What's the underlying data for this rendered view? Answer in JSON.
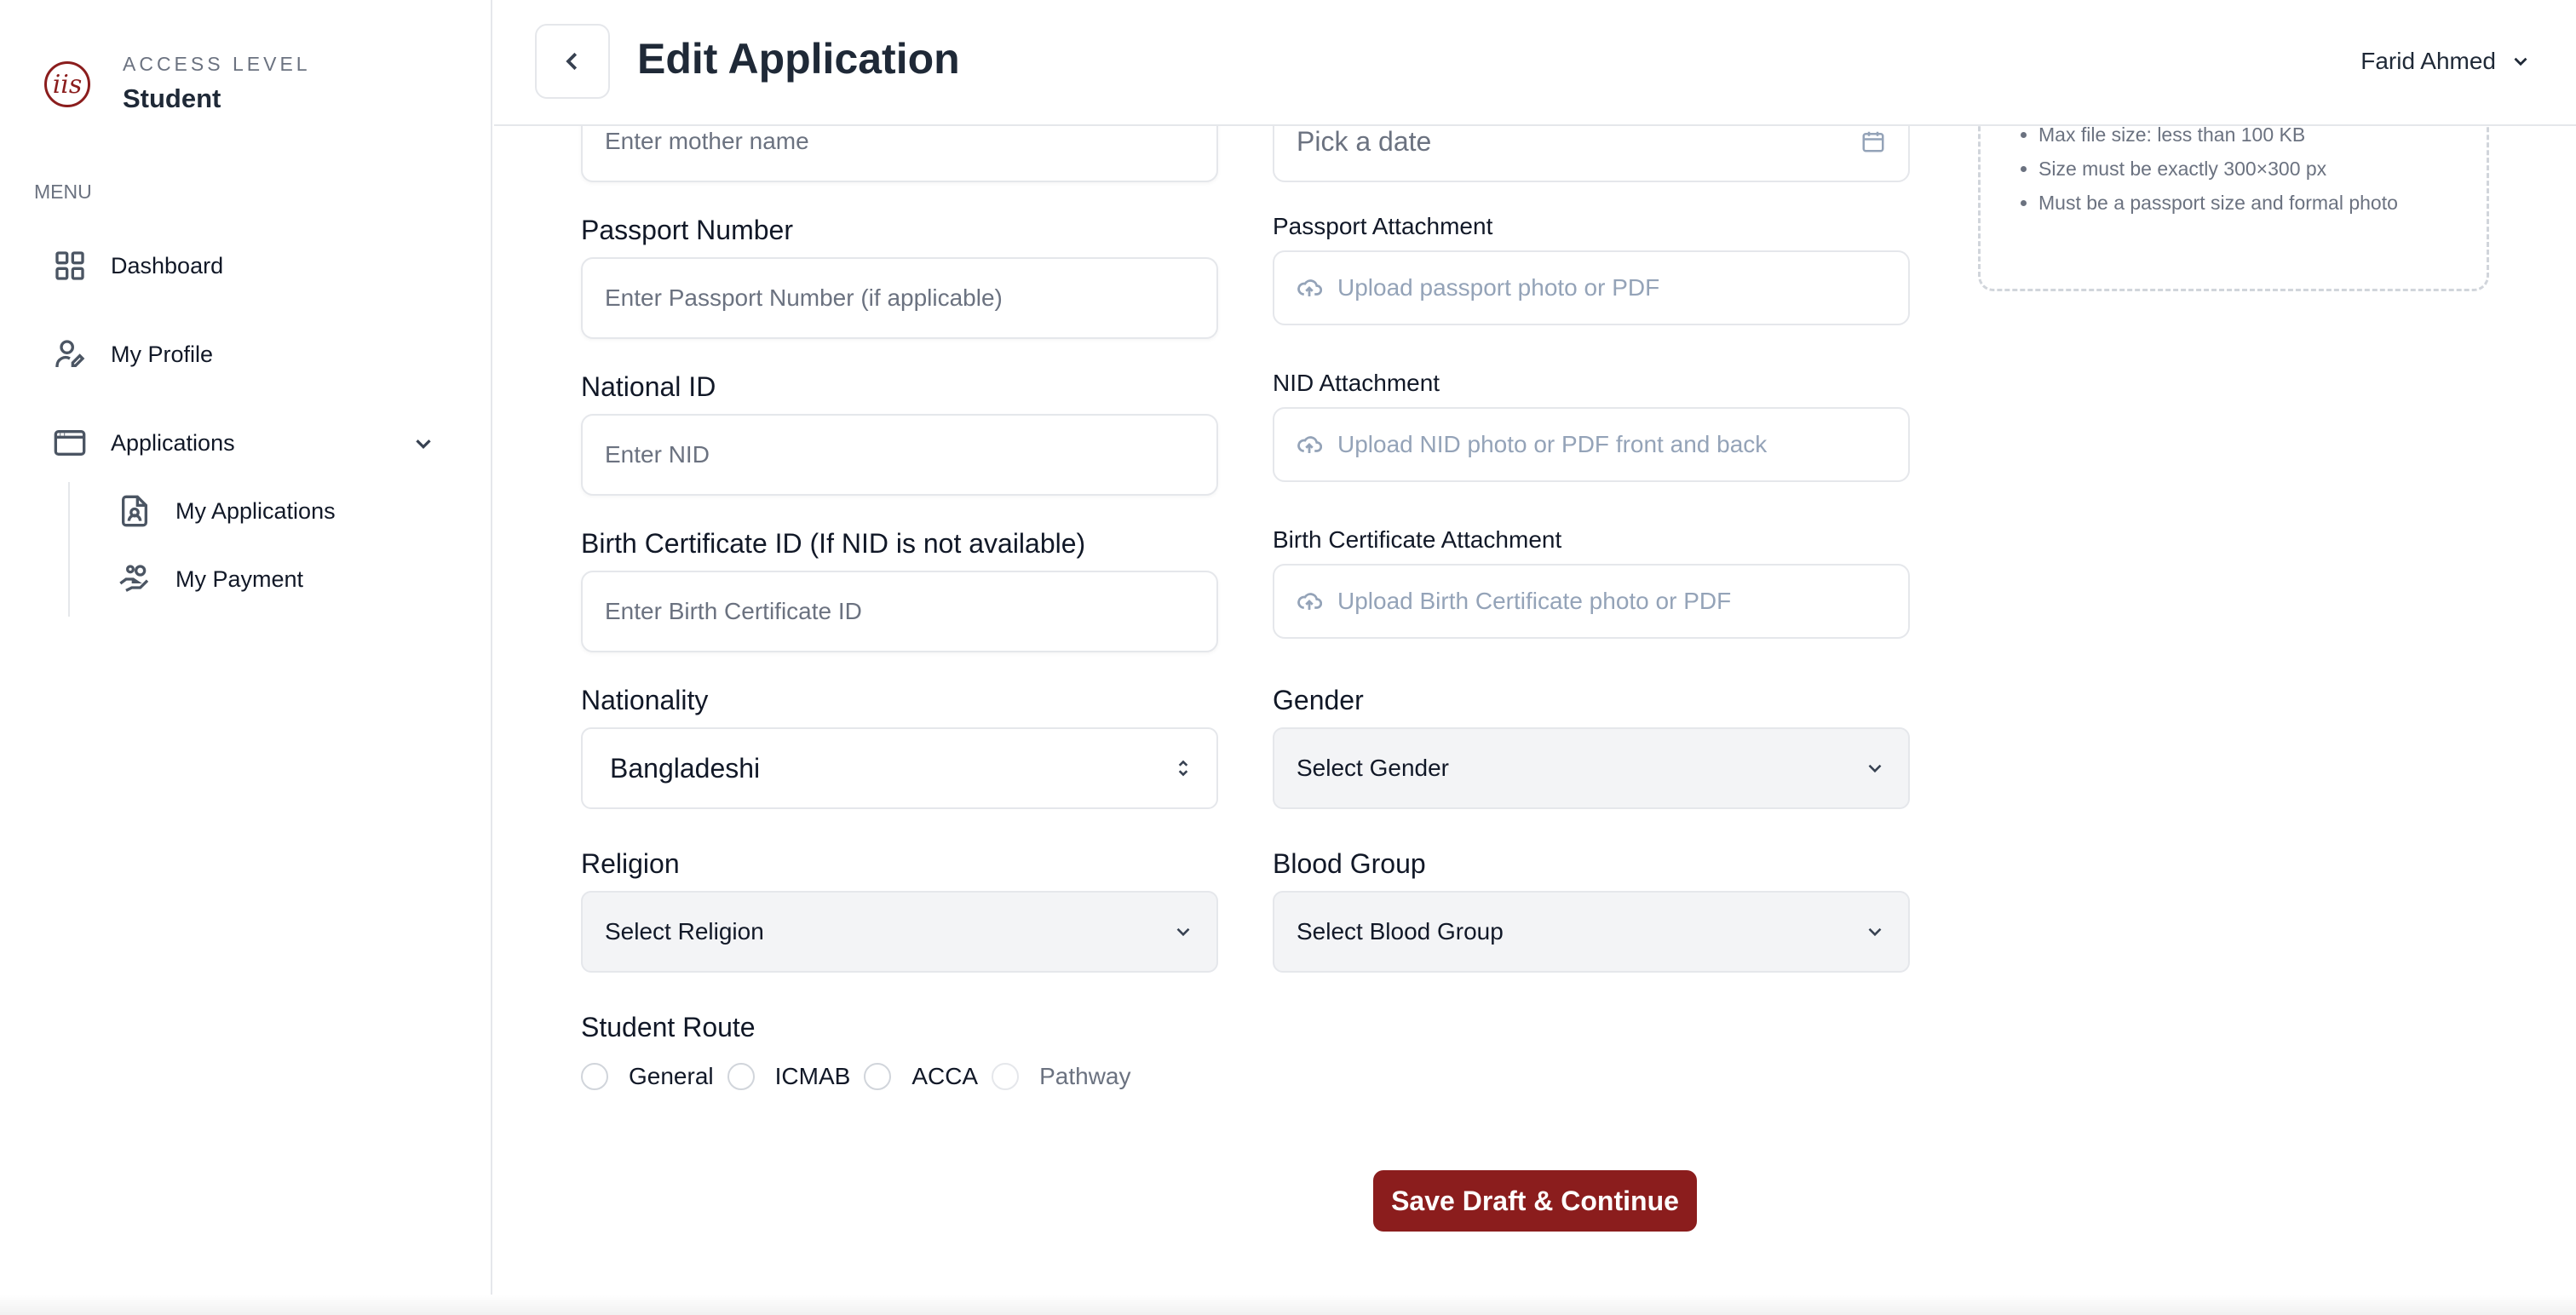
{
  "sidebar": {
    "logo_text": "iis",
    "access_label": "ACCESS LEVEL",
    "access_value": "Student",
    "menu_label": "MENU",
    "items": [
      {
        "label": "Dashboard",
        "icon": "grid-icon"
      },
      {
        "label": "My Profile",
        "icon": "user-edit-icon"
      },
      {
        "label": "Applications",
        "icon": "browser-window-icon",
        "expanded": true
      }
    ],
    "subitems": [
      {
        "label": "My Applications",
        "icon": "document-user-icon"
      },
      {
        "label": "My Payment",
        "icon": "hand-coins-icon"
      }
    ]
  },
  "header": {
    "title": "Edit Application",
    "user_name": "Farid Ahmed"
  },
  "form": {
    "mother_name_placeholder": "Enter mother name",
    "date_placeholder": "Pick a date",
    "passport_label": "Passport Number",
    "passport_placeholder": "Enter Passport Number (if applicable)",
    "passport_attachment_label": "Passport Attachment",
    "passport_attachment_text": "Upload passport photo or PDF",
    "nid_label": "National ID",
    "nid_placeholder": "Enter NID",
    "nid_attachment_label": "NID Attachment",
    "nid_attachment_text": "Upload NID photo or PDF front and back",
    "birth_label": "Birth Certificate ID (If NID is not available)",
    "birth_placeholder": "Enter Birth Certificate ID",
    "birth_attachment_label": "Birth Certificate Attachment",
    "birth_attachment_text": "Upload Birth Certificate photo or PDF",
    "nationality_label": "Nationality",
    "nationality_value": "Bangladeshi",
    "gender_label": "Gender",
    "gender_value": "Select Gender",
    "religion_label": "Religion",
    "religion_value": "Select Religion",
    "blood_label": "Blood Group",
    "blood_value": "Select Blood Group",
    "route_label": "Student Route",
    "route_options": [
      "General",
      "ICMAB",
      "ACCA",
      "Pathway"
    ],
    "save_label": "Save Draft & Continue"
  },
  "photo_requirements": [
    "Max file size: less than 100 KB",
    "Size must be exactly 300×300 px",
    "Must be a passport size and formal photo"
  ],
  "colors": {
    "brand": "#8b1d1d",
    "select_bg": "#f3f4f6",
    "border": "#e5e7eb"
  }
}
